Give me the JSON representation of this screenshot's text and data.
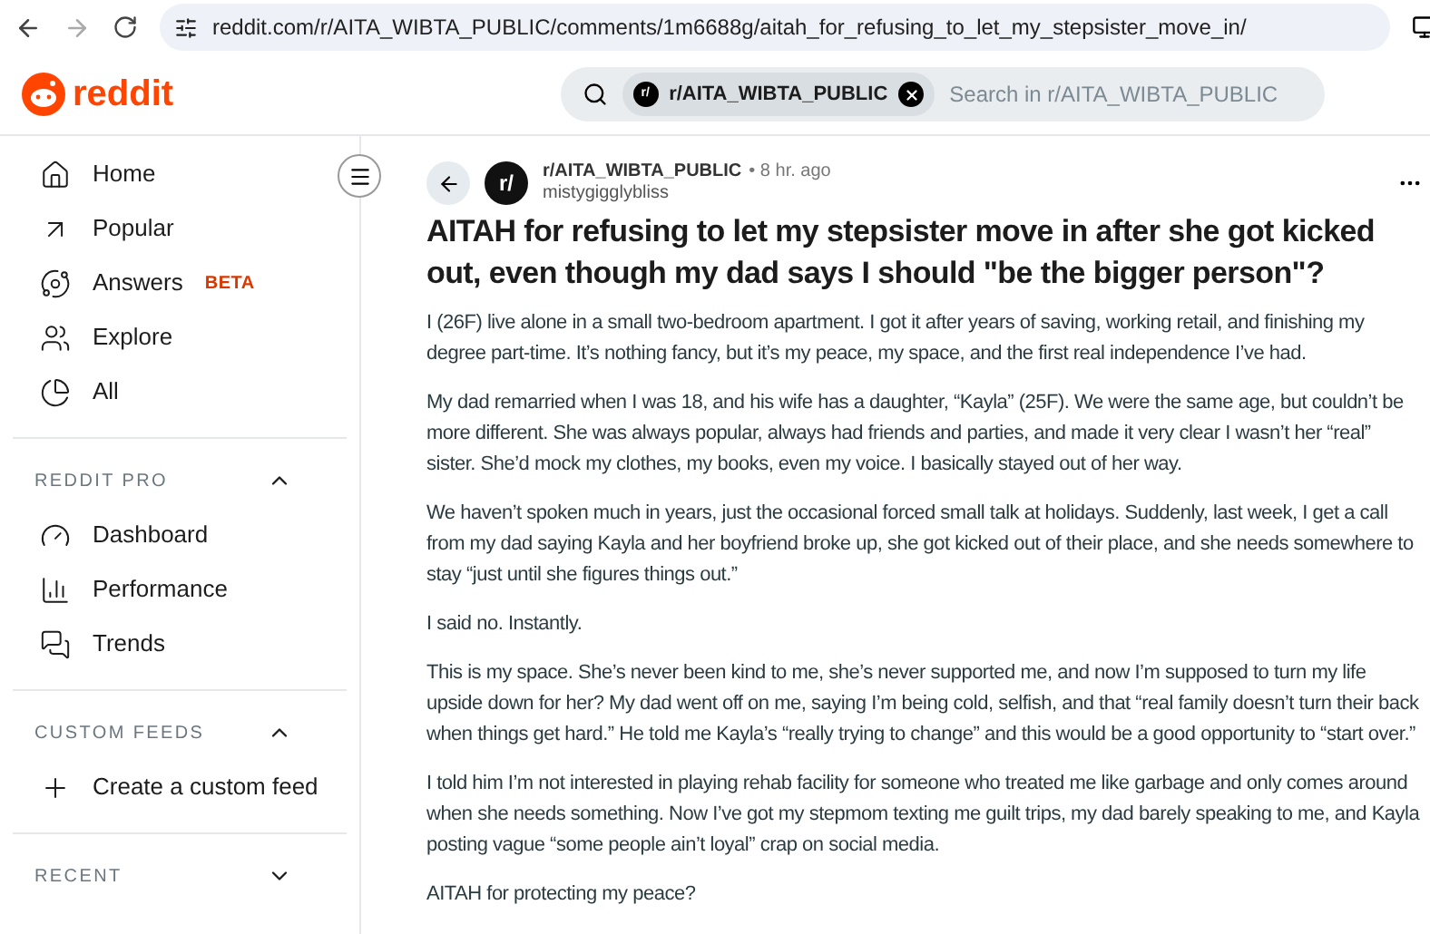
{
  "browser": {
    "url": "reddit.com/r/AITA_WIBTA_PUBLIC/comments/1m6688g/aitah_for_refusing_to_let_my_stepsister_move_in/"
  },
  "header": {
    "logo": "reddit",
    "search_chip": "r/AITA_WIBTA_PUBLIC",
    "chip_icon": "r/",
    "search_placeholder": "Search in r/AITA_WIBTA_PUBLIC"
  },
  "sidebar": {
    "items": [
      {
        "kind": "home",
        "label": "Home"
      },
      {
        "kind": "popular",
        "label": "Popular"
      },
      {
        "kind": "answers",
        "label": "Answers",
        "badge": "BETA"
      },
      {
        "kind": "explore",
        "label": "Explore"
      },
      {
        "kind": "all",
        "label": "All"
      }
    ],
    "sections": [
      {
        "title": "REDDIT PRO",
        "expanded": true,
        "items": [
          {
            "kind": "dashboard",
            "label": "Dashboard"
          },
          {
            "kind": "performance",
            "label": "Performance"
          },
          {
            "kind": "trends",
            "label": "Trends"
          }
        ]
      },
      {
        "title": "CUSTOM FEEDS",
        "expanded": true,
        "items": [
          {
            "kind": "create",
            "label": "Create a custom feed"
          }
        ]
      },
      {
        "title": "RECENT",
        "expanded": false
      }
    ]
  },
  "post": {
    "avatar": "r/",
    "subreddit": "r/AITA_WIBTA_PUBLIC",
    "time": "• 8 hr. ago",
    "author": "mistygigglybliss",
    "title": "AITAH for refusing to let my stepsister move in after she got kicked out, even though my dad says I should \"be the bigger person\"?",
    "paragraphs": [
      "I (26F) live alone in a small two-bedroom apartment. I got it after years of saving, working retail, and finishing my degree part-time. It’s nothing fancy, but it’s my peace, my space, and the first real independence I’ve had.",
      "My dad remarried when I was 18, and his wife has a daughter, “Kayla” (25F). We were the same age, but couldn’t be more different. She was always popular, always had friends and parties, and made it very clear I wasn’t her “real” sister. She’d mock my clothes, my books, even my voice. I basically stayed out of her way.",
      "We haven’t spoken much in years, just the occasional forced small talk at holidays. Suddenly, last week, I get a call from my dad saying Kayla and her boyfriend broke up, she got kicked out of their place, and she needs somewhere to stay “just until she figures things out.”",
      "I said no. Instantly.",
      "This is my space. She’s never been kind to me, she’s never supported me, and now I’m supposed to turn my life upside down for her? My dad went off on me, saying I’m being cold, selfish, and that “real family doesn’t turn their back when things get hard.” He told me Kayla’s “really trying to change” and this would be a good opportunity to “start over.”",
      "I told him I’m not interested in playing rehab facility for someone who treated me like garbage and only comes around when she needs something. Now I’ve got my stepmom texting me guilt trips, my dad barely speaking to me, and Kayla posting vague “some people ain’t loyal” crap on social media.",
      "AITAH for protecting my peace?"
    ]
  }
}
